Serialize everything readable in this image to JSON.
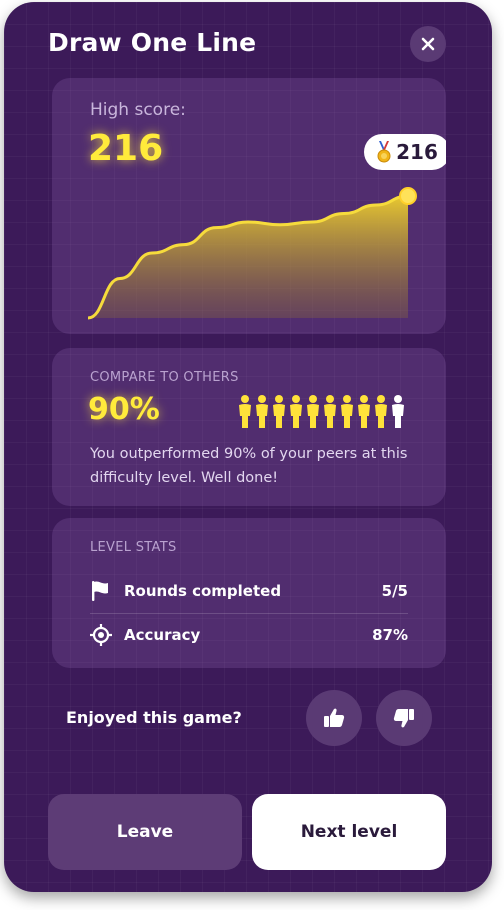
{
  "header": {
    "title": "Draw One Line"
  },
  "high_score": {
    "label": "High score:",
    "value": "216",
    "badge_value": "216"
  },
  "chart_data": {
    "type": "area",
    "x": [
      0,
      1,
      2,
      3,
      4,
      5,
      6,
      7,
      8,
      9,
      10
    ],
    "values": [
      0,
      70,
      115,
      130,
      160,
      170,
      165,
      170,
      185,
      200,
      216
    ],
    "highlight_last_point": true,
    "fill_color": "#e6c52e",
    "title": "",
    "xlabel": "",
    "ylabel": ""
  },
  "compare": {
    "label": "COMPARE TO OTHERS",
    "percent": "90%",
    "percentile_value": 90,
    "people_total": 10,
    "people_highlighted": 9,
    "description": "You outperformed 90% of your peers at this difficulty level. Well done!"
  },
  "level_stats": {
    "label": "LEVEL STATS",
    "rows": [
      {
        "label": "Rounds completed",
        "value": "5/5",
        "icon": "flag-icon"
      },
      {
        "label": "Accuracy",
        "value": "87%",
        "icon": "target-icon"
      }
    ]
  },
  "feedback": {
    "prompt": "Enjoyed this game?"
  },
  "actions": {
    "leave": "Leave",
    "next": "Next level"
  },
  "colors": {
    "background": "#3c1a59",
    "accent": "#ffeb3b",
    "card": "#55336f"
  }
}
